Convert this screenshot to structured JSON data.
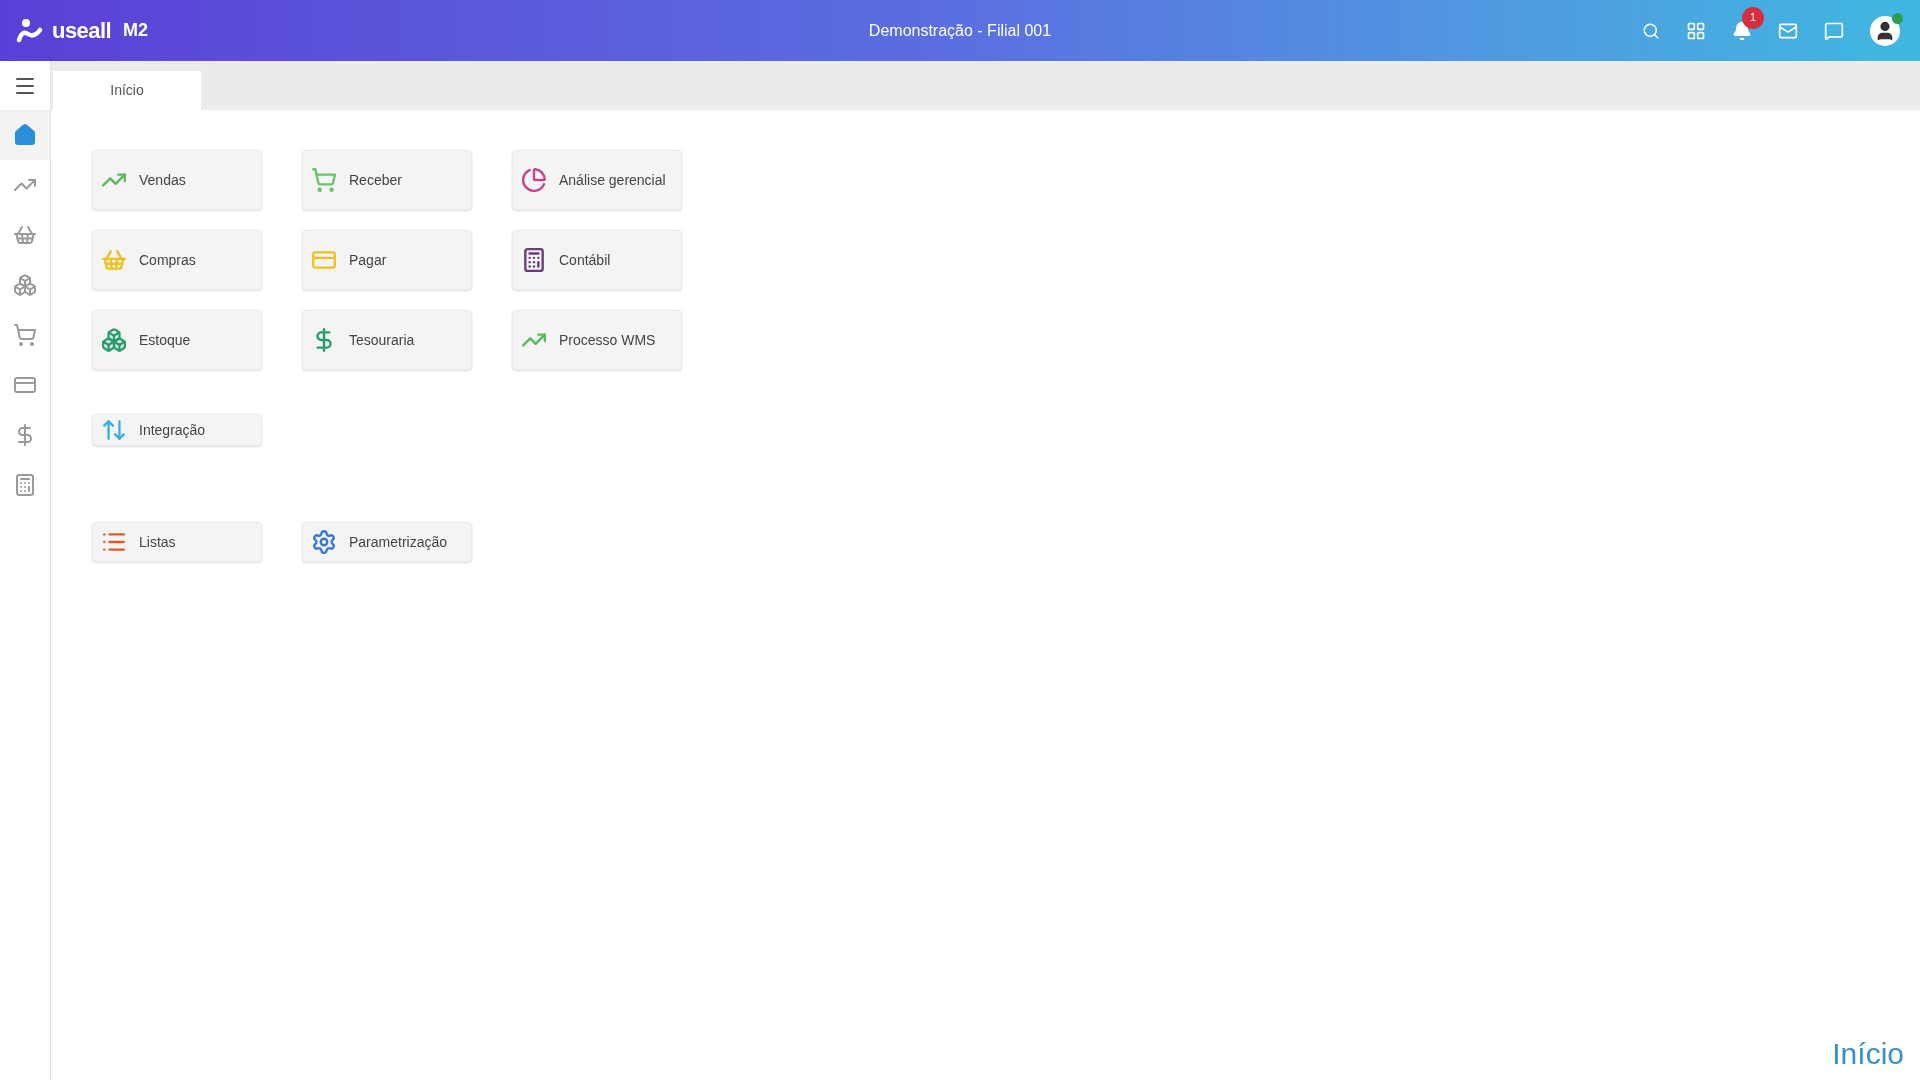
{
  "header": {
    "logo_text": "useall",
    "logo_suffix": "M2",
    "title": "Demonstração - Filial 001",
    "notification_count": "1"
  },
  "sidebar": {
    "items": [
      {
        "selected": true
      },
      {
        "selected": false
      },
      {
        "selected": false
      },
      {
        "selected": false
      },
      {
        "selected": false
      },
      {
        "selected": false
      },
      {
        "selected": false
      },
      {
        "selected": false
      }
    ]
  },
  "tabs": [
    {
      "label": "Início",
      "selected": true
    }
  ],
  "modules": [
    {
      "label": "Vendas"
    },
    {
      "label": "Receber"
    },
    {
      "label": "Análise gerencial"
    },
    {
      "label": "Compras"
    },
    {
      "label": "Pagar"
    },
    {
      "label": "Contábil"
    },
    {
      "label": "Estoque"
    },
    {
      "label": "Tesouraria"
    },
    {
      "label": "Processo WMS"
    }
  ],
  "integration": [
    {
      "label": "Integração"
    }
  ],
  "settings": [
    {
      "label": "Listas"
    },
    {
      "label": "Parametrização"
    }
  ],
  "footer": {
    "page_label": "Início"
  }
}
